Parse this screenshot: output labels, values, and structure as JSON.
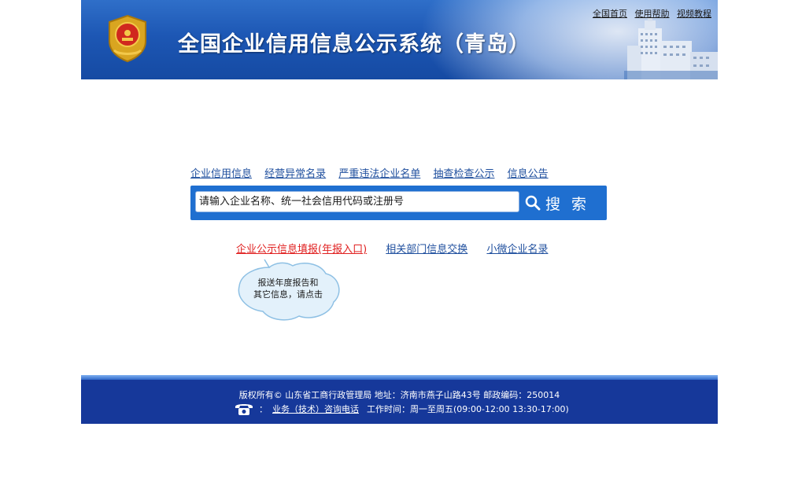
{
  "header": {
    "title": "全国企业信用信息公示系统（青岛）",
    "links": [
      "全国首页",
      "使用帮助",
      "视频教程"
    ]
  },
  "nav": {
    "links": [
      "企业信用信息",
      "经营异常名录",
      "严重违法企业名单",
      "抽查检查公示",
      "信息公告"
    ]
  },
  "search": {
    "placeholder": "请输入企业名称、统一社会信用代码或注册号",
    "button_label": "搜 索"
  },
  "secondary_links": {
    "annual_report": "企业公示信息填报(年报入口)",
    "dept_exchange": "相关部门信息交换",
    "micro_enterprise": "小微企业名录"
  },
  "tooltip": {
    "line1": "报送年度报告和",
    "line2": "其它信息，请点击"
  },
  "footer": {
    "line1": "版权所有© 山东省工商行政管理局    地址：济南市燕子山路43号    邮政编码：250014",
    "colon": "：",
    "phone_label": "业务（技术）咨询电话",
    "hours": "工作时间：周一至周五(09:00-12:00 13:30-17:00)"
  },
  "colors": {
    "header_blue": "#1d57b4",
    "search_blue": "#1f6fd0",
    "link_blue": "#1f4f9e",
    "link_red": "#e02020",
    "footer_blue": "#16389a"
  },
  "icons": [
    "national-emblem-icon",
    "search-icon",
    "telephone-icon"
  ]
}
